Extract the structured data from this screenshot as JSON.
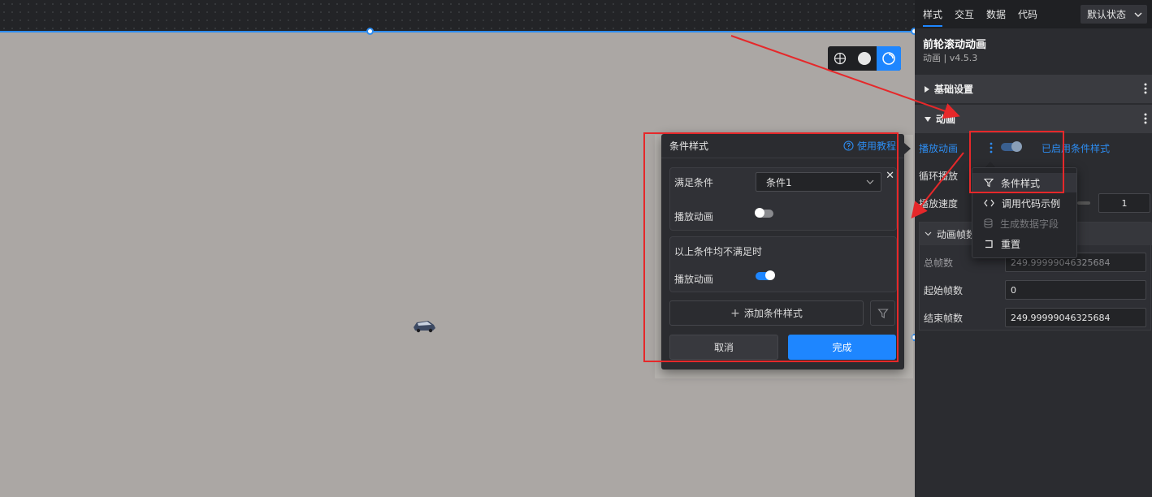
{
  "colors": {
    "accent": "#1e86ff",
    "annotation": "#e6282a",
    "panel": "#2b2c30",
    "canvas": "#aba7a4"
  },
  "view_tools": {
    "items": [
      "globe-icon",
      "circle-icon",
      "rotate-icon"
    ]
  },
  "panel": {
    "tabs": [
      {
        "label": "样式"
      },
      {
        "label": "交互"
      },
      {
        "label": "数据"
      },
      {
        "label": "代码"
      }
    ],
    "state_select": "默认状态",
    "component": {
      "title": "前轮滚动动画",
      "version": "动画 | v4.5.3"
    },
    "sections": {
      "basic": "基础设置",
      "animation": "动画"
    },
    "play_label": "播放动画",
    "condition_enabled": "已启用条件样式",
    "loop_label": "循环播放",
    "speed_label": "播放速度",
    "speed_value": "1",
    "frames": {
      "header": "动画帧数",
      "total_label": "总帧数",
      "total_value": "249.99999046325684",
      "start_label": "起始帧数",
      "start_value": "0",
      "end_label": "结束帧数",
      "end_value": "249.99999046325684"
    }
  },
  "menu": {
    "items": [
      {
        "label": "条件样式",
        "icon": "filter-icon"
      },
      {
        "label": "调用代码示例",
        "icon": "code-icon"
      },
      {
        "label": "生成数据字段",
        "icon": "database-icon"
      },
      {
        "label": "重置",
        "icon": "reset-icon"
      }
    ]
  },
  "popup": {
    "title": "条件样式",
    "help": "使用教程",
    "condition_label": "满足条件",
    "condition_value": "条件1",
    "play_label_1": "播放动画",
    "play_1_on": false,
    "else_label": "以上条件均不满足时",
    "play_label_2": "播放动画",
    "play_2_on": true,
    "add_button": "添加条件样式",
    "cancel": "取消",
    "done": "完成"
  }
}
